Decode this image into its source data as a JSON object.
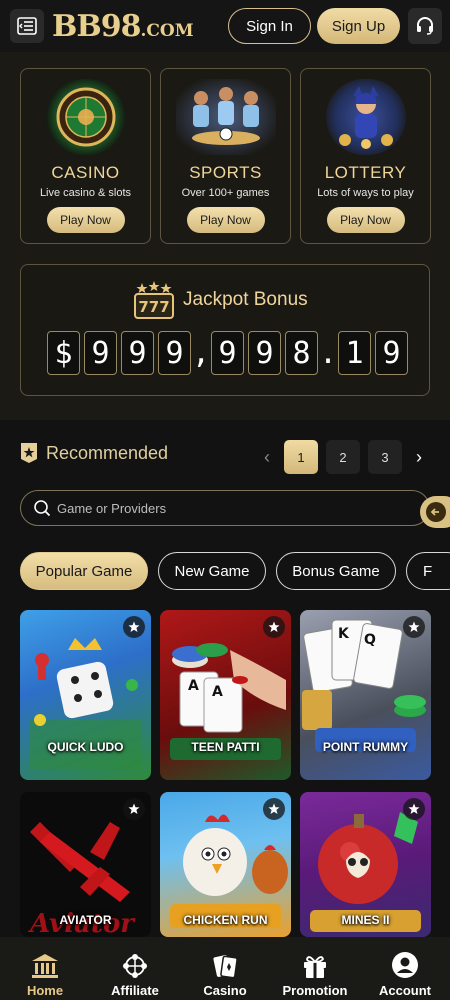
{
  "header": {
    "logo_main": "BB98",
    "logo_suffix": ".COM",
    "sign_in": "Sign In",
    "sign_up": "Sign Up",
    "menu_icon": "menu-icon",
    "support_icon": "headset-icon"
  },
  "categories": [
    {
      "title": "CASINO",
      "subtitle": "Live casino & slots",
      "button": "Play Now",
      "icon": "roulette-icon"
    },
    {
      "title": "SPORTS",
      "subtitle": "Over 100+ games",
      "button": "Play Now",
      "icon": "football-players-icon"
    },
    {
      "title": "LOTTERY",
      "subtitle": "Lots of ways to play",
      "button": "Play Now",
      "icon": "lottery-heroine-icon"
    }
  ],
  "jackpot": {
    "title": "Jackpot Bonus",
    "currency": "$",
    "amount_chars": [
      "9",
      "9",
      "9",
      ",",
      "9",
      "9",
      "8",
      ".",
      "1",
      "9"
    ]
  },
  "recommended": {
    "title": "Recommended",
    "pages": [
      "1",
      "2",
      "3"
    ],
    "active_page": "1"
  },
  "search": {
    "placeholder": "Game or Providers"
  },
  "filters": [
    "Popular Game",
    "New Game",
    "Bonus Game",
    "F"
  ],
  "games": [
    {
      "name": "QUICK LUDO"
    },
    {
      "name": "TEEN PATTI"
    },
    {
      "name": "POINT RUMMY"
    },
    {
      "name": "AVIATOR"
    },
    {
      "name": "CHICKEN RUN"
    },
    {
      "name": "MINES II"
    }
  ],
  "nav": [
    {
      "label": "Home",
      "icon": "bank-icon"
    },
    {
      "label": "Affiliate",
      "icon": "network-icon"
    },
    {
      "label": "Casino",
      "icon": "cards-icon"
    },
    {
      "label": "Promotion",
      "icon": "gift-icon"
    },
    {
      "label": "Account",
      "icon": "user-icon"
    }
  ],
  "colors": {
    "accent_gold": "#e8cf8e",
    "background": "#121212",
    "card_border": "#5e5540"
  }
}
